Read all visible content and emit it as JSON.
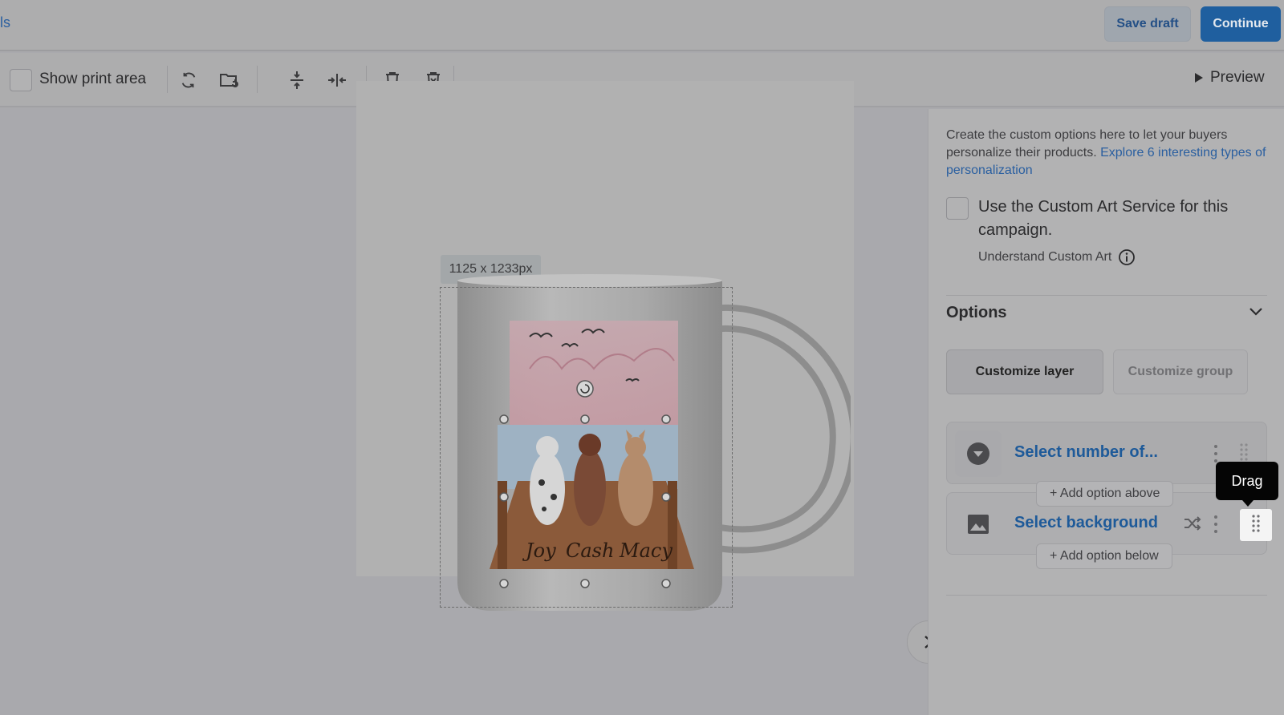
{
  "header": {
    "back_label": "ls",
    "save_draft_label": "Save draft",
    "continue_label": "Continue"
  },
  "toolbar": {
    "show_print_area_label": "Show print area",
    "preview_label": "Preview",
    "icons": [
      "refresh-icon",
      "replace-image-icon",
      "align-vertical-center-icon",
      "align-horizontal-center-icon",
      "delete-icon",
      "delete-all-icon"
    ]
  },
  "canvas": {
    "dimension_badge": "1125 x 1233px",
    "mug_names": [
      "Joy",
      "Cash",
      "Macy"
    ]
  },
  "panel": {
    "intro_text": "Create the custom options here to let your buyers personalize their products.",
    "intro_link": "Explore 6 interesting types of personalization",
    "custom_art_label": "Use the Custom Art Service for this campaign.",
    "understand_label": "Understand Custom Art",
    "options_title": "Options",
    "customize_layer_label": "Customize layer",
    "customize_group_label": "Customize group",
    "options": [
      {
        "label": "Select number of...",
        "icon": "dropdown-icon"
      },
      {
        "label": "Select background",
        "icon": "image-icon"
      }
    ],
    "add_option_above": "+ Add option above",
    "add_option_below": "+ Add option below",
    "drag_tooltip": "Drag"
  },
  "colors": {
    "accent": "#1f5f9f",
    "link": "#2a5fa0",
    "overlay_bg": "#a9a9ad"
  }
}
